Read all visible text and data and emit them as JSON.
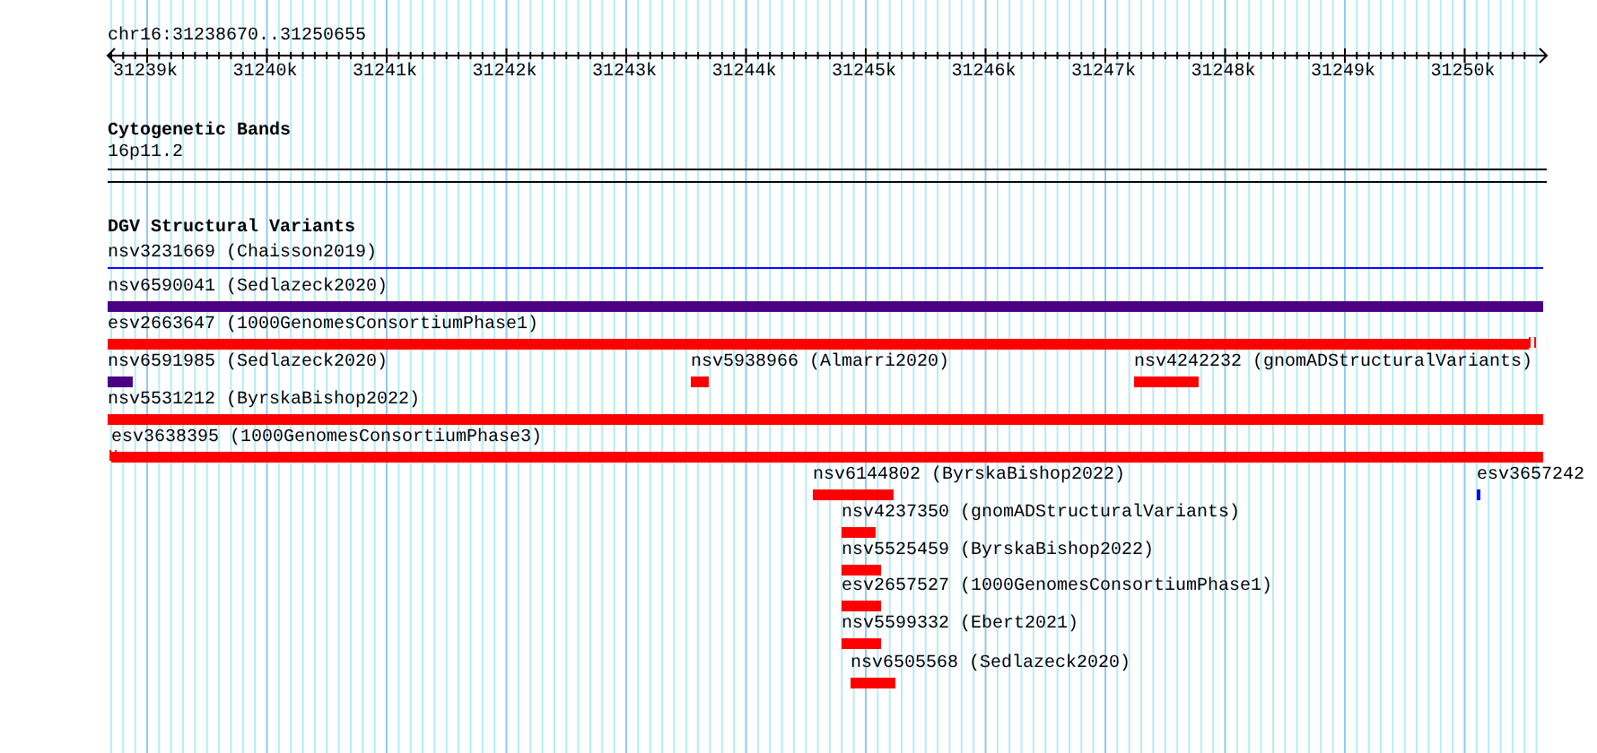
{
  "location": "chr16:31238670..31250655",
  "ruler": {
    "ticks": [
      "31239k",
      "31240k",
      "31241k",
      "31242k",
      "31243k",
      "31244k",
      "31245k",
      "31246k",
      "31247k",
      "31248k",
      "31249k",
      "31250k"
    ]
  },
  "bands_track": {
    "title": "Cytogenetic Bands",
    "band": "16p11.2"
  },
  "variants_track": {
    "title": "DGV Structural Variants",
    "features": [
      {
        "label": "nsv3231669 (Chaisson2019)",
        "kind": "line",
        "color": "#0000ff"
      },
      {
        "label": "nsv6590041 (Sedlazeck2020)",
        "kind": "bar",
        "color": "#4b0082"
      },
      {
        "label": "esv2663647 (1000GenomesConsortiumPhase1)",
        "kind": "bar",
        "color": "#ff0000"
      },
      {
        "label": "nsv6591985 (Sedlazeck2020)",
        "kind": "bar",
        "color": "#4b0082"
      },
      {
        "label": "nsv5938966 (Almarri2020)",
        "kind": "bar",
        "color": "#ff0000"
      },
      {
        "label": "nsv4242232 (gnomADStructuralVariants)",
        "kind": "bar",
        "color": "#ff0000"
      },
      {
        "label": "nsv5531212 (ByrskaBishop2022)",
        "kind": "bar",
        "color": "#ff0000"
      },
      {
        "label": "esv3638395 (1000GenomesConsortiumPhase3)",
        "kind": "bar",
        "color": "#ff0000"
      },
      {
        "label": "nsv6144802 (ByrskaBishop2022)",
        "kind": "bar",
        "color": "#ff0000"
      },
      {
        "label": "esv3657242",
        "kind": "bar",
        "color": "#0000ff"
      },
      {
        "label": "nsv4237350 (gnomADStructuralVariants)",
        "kind": "bar",
        "color": "#ff0000"
      },
      {
        "label": "nsv5525459 (ByrskaBishop2022)",
        "kind": "bar",
        "color": "#ff0000"
      },
      {
        "label": "esv2657527 (1000GenomesConsortiumPhase1)",
        "kind": "bar",
        "color": "#ff0000"
      },
      {
        "label": "nsv5599332 (Ebert2021)",
        "kind": "bar",
        "color": "#ff0000"
      },
      {
        "label": "nsv6505568 (Sedlazeck2020)",
        "kind": "bar",
        "color": "#ff0000"
      }
    ]
  }
}
